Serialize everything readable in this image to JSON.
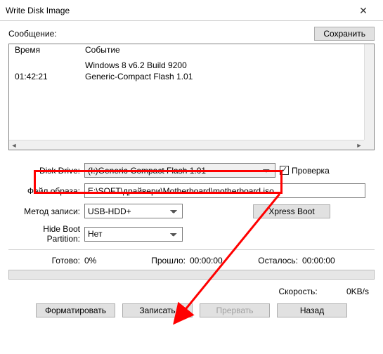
{
  "window": {
    "title": "Write Disk Image"
  },
  "top": {
    "message_label": "Сообщение:",
    "save_label": "Сохранить"
  },
  "log": {
    "headers": {
      "time": "Время",
      "event": "Событие"
    },
    "rows": [
      {
        "time": "",
        "event": "Windows 8 v6.2 Build 9200"
      },
      {
        "time": "01:42:21",
        "event": "Generic-Compact Flash   1.01"
      }
    ]
  },
  "form": {
    "disk_drive_label": "Disk Drive:",
    "disk_drive_value": "(I:)Generic-Compact Flash   1.01",
    "check_label": "Проверка",
    "image_file_label": "Файл образа:",
    "image_file_value": "E:\\SOFT\\драйвери\\Motherboard\\motherboard.iso",
    "write_method_label": "Метод записи:",
    "write_method_value": "USB-HDD+",
    "xpress_boot_label": "Xpress Boot",
    "hide_boot_label": "Hide Boot Partition:",
    "hide_boot_value": "Нет"
  },
  "status": {
    "ready_label": "Готово:",
    "ready_value": "0%",
    "elapsed_label": "Прошло:",
    "elapsed_value": "00:00:00",
    "remaining_label": "Осталось:",
    "remaining_value": "00:00:00",
    "speed_label": "Скорость:",
    "speed_value": "0KB/s"
  },
  "buttons": {
    "format": "Форматировать",
    "write": "Записать",
    "abort": "Прервать",
    "back": "Назад"
  }
}
